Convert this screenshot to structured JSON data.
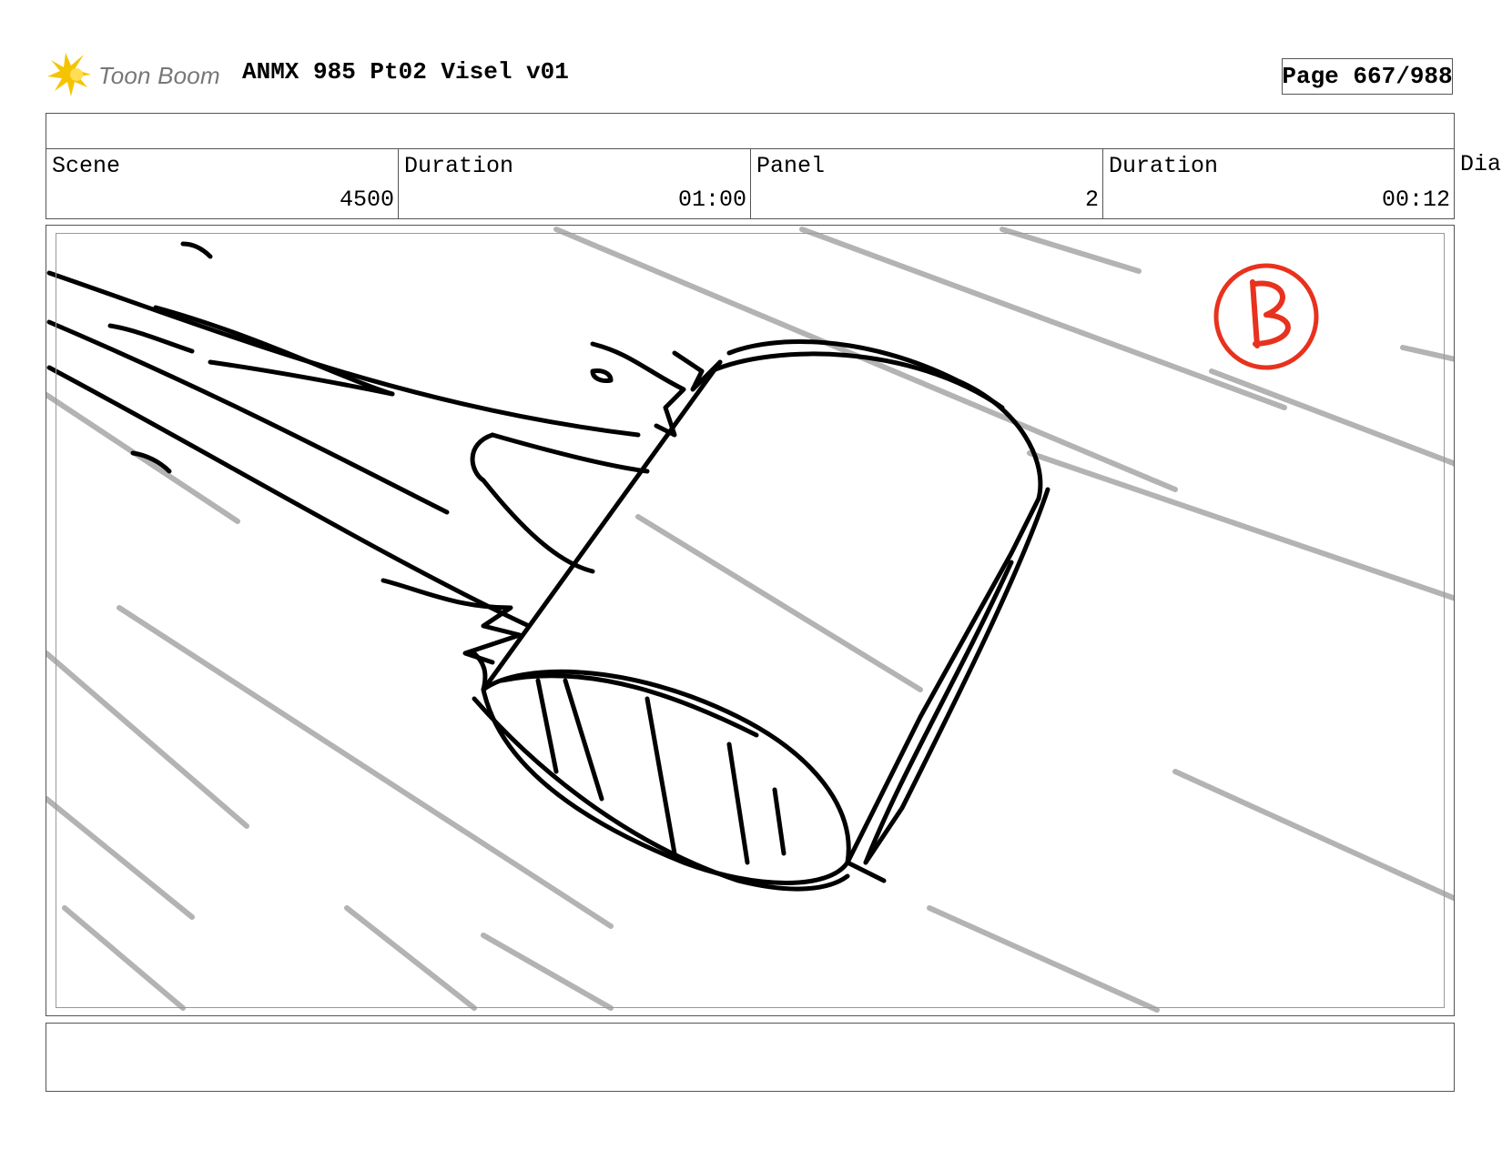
{
  "header": {
    "logo_text": "Toon Boom",
    "title": "ANMX 985 Pt02 Visel v01",
    "page_label": "Page",
    "page_value": "667/988"
  },
  "info": {
    "scene_label": "Scene",
    "scene_value": "4500",
    "scene_duration_label": "Duration",
    "scene_duration_value": "01:00",
    "panel_label": "Panel",
    "panel_value": "2",
    "panel_duration_label": "Duration",
    "panel_duration_value": "00:12",
    "dialogue_label": "Dia"
  },
  "sketch": {
    "panel_mark_color": "#e8321e",
    "speed_line_color": "#b3b3b3",
    "ink_color": "#000000"
  },
  "dialogue": {
    "text": ""
  }
}
